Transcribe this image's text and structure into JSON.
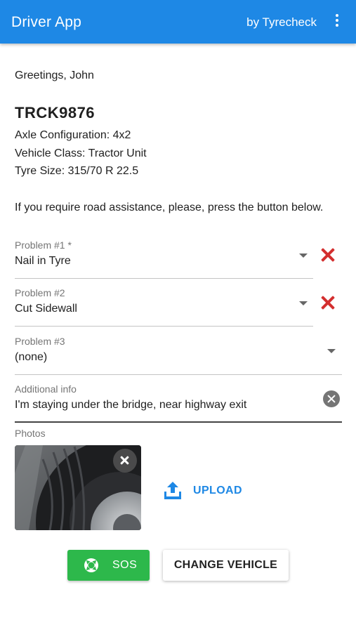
{
  "app": {
    "title": "Driver App",
    "by_label": "by Tyrecheck",
    "menu_icon": "more-vert-icon",
    "primary_color": "#1e88e5"
  },
  "greeting": "Greetings, John",
  "vehicle": {
    "plate": "TRCK9876",
    "axle_configuration": "Axle Configuration: 4x2",
    "vehicle_class": "Vehicle Class: Tractor Unit",
    "tyre_size": "Tyre Size: 315/70 R 22.5"
  },
  "assistance_text": "If you require road assistance, please, press the button below.",
  "problems": [
    {
      "label": "Problem #1 *",
      "value": "Nail in Tyre",
      "removable": true
    },
    {
      "label": "Problem #2",
      "value": "Cut Sidewall",
      "removable": true
    },
    {
      "label": "Problem #3",
      "value": "(none)",
      "removable": false
    }
  ],
  "additional_info": {
    "label": "Additional info",
    "value": "I'm staying under the bridge, near highway exit"
  },
  "photos": {
    "label": "Photos",
    "upload_label": "UPLOAD",
    "upload_icon": "upload-icon",
    "remove_icon": "close-icon"
  },
  "buttons": {
    "sos_label": "SOS",
    "sos_icon": "lifebuoy-icon",
    "sos_color": "#2db84b",
    "change_vehicle_label": "CHANGE VEHICLE"
  },
  "colors": {
    "remove_red": "#d32f2f",
    "label_grey": "#757575"
  }
}
